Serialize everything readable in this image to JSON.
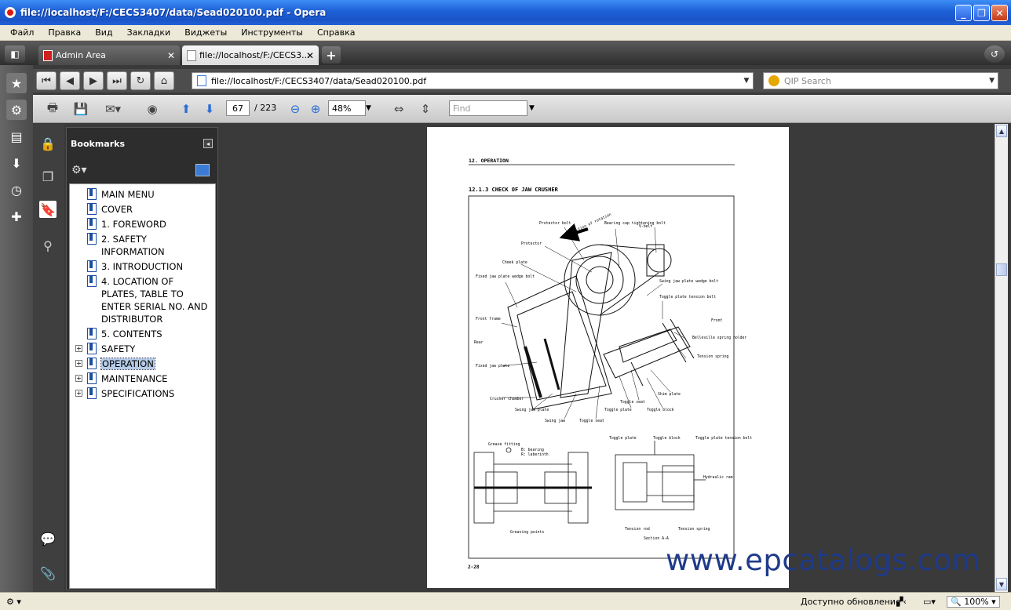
{
  "window": {
    "title": "file://localhost/F:/CECS3407/data/Sead020100.pdf - Opera"
  },
  "menu": [
    "Файл",
    "Правка",
    "Вид",
    "Закладки",
    "Виджеты",
    "Инструменты",
    "Справка"
  ],
  "tabs": [
    {
      "label": "Admin Area"
    },
    {
      "label": "file://localhost/F:/CECS3..."
    }
  ],
  "address": {
    "url": "file://localhost/F:/CECS3407/data/Sead020100.pdf",
    "search_placeholder": "QIP Search"
  },
  "pdf_toolbar": {
    "page_current": "67",
    "page_total": "/ 223",
    "zoom": "48%",
    "find_placeholder": "Find"
  },
  "bookmarks": {
    "title": "Bookmarks",
    "items": [
      {
        "label": "MAIN MENU",
        "expandable": false
      },
      {
        "label": "COVER",
        "expandable": false
      },
      {
        "label": "1. FOREWORD",
        "expandable": false
      },
      {
        "label": "2. SAFETY INFORMATION",
        "expandable": false
      },
      {
        "label": "3. INTRODUCTION",
        "expandable": false
      },
      {
        "label": "4. LOCATION OF PLATES, TABLE TO ENTER SERIAL NO. AND DISTRIBUTOR",
        "expandable": false
      },
      {
        "label": "5. CONTENTS",
        "expandable": false
      },
      {
        "label": "SAFETY",
        "expandable": true
      },
      {
        "label": "OPERATION",
        "expandable": true,
        "selected": true
      },
      {
        "label": "MAINTENANCE",
        "expandable": true
      },
      {
        "label": "SPECIFICATIONS",
        "expandable": true
      }
    ]
  },
  "document_page": {
    "header": "12. OPERATION",
    "section_title": "12.1.3 CHECK OF JAW CRUSHER",
    "labels": {
      "protector_bolt": "Protector bolt",
      "direction": "Direction of rotation",
      "bearing_cap": "Bearing cap tightening bolt",
      "vbelt": "V-belt",
      "protector": "Protector",
      "cheek_plate": "Cheek plate",
      "fixed_jaw_wedge": "Fixed jaw plate wedge bolt",
      "swing_jaw_wedge": "Swing jaw plate wedge bolt",
      "toggle_tension_bolt": "Toggle plate tension bolt",
      "front": "Front",
      "front_frame": "Front frame",
      "rear": "Rear",
      "belleville": "Belleville spring holder",
      "tension_spring": "Tension spring",
      "fixed_jaw_plate": "Fixed jaw plate",
      "shim_plate": "Shim plate",
      "toggle_seat": "Toggle seat",
      "toggle_plate": "Toggle plate",
      "toggle_block": "Toggle block",
      "crusher_chamber": "Crusher chamber",
      "swing_jaw_plate": "Swing jaw plate",
      "swing_jaw": "Swing jaw",
      "grease_fitting": "Grease fitting",
      "bearing_b": "B: bearing",
      "bearing_r": "R: laberinth",
      "greasing_points": "Greasing points",
      "tb_toggle_plate": "Toggle plate",
      "tb_toggle_block": "Toggle block",
      "tb_tension_bolt": "Toggle plate tension bolt",
      "hydraulic_ram": "Hydraulic ram",
      "tension_rod": "Tension rod",
      "tb_tension_spring": "Tension spring",
      "section": "Section A-A",
      "page_no": "2-28"
    }
  },
  "watermark": "www.epcatalogs.com",
  "status": {
    "update": "Доступно обновление",
    "zoom": "100%"
  },
  "colors": {
    "titlebar": "#1d5fd6",
    "selection": "#b5cbe8",
    "watermark": "#1e3a8a"
  }
}
